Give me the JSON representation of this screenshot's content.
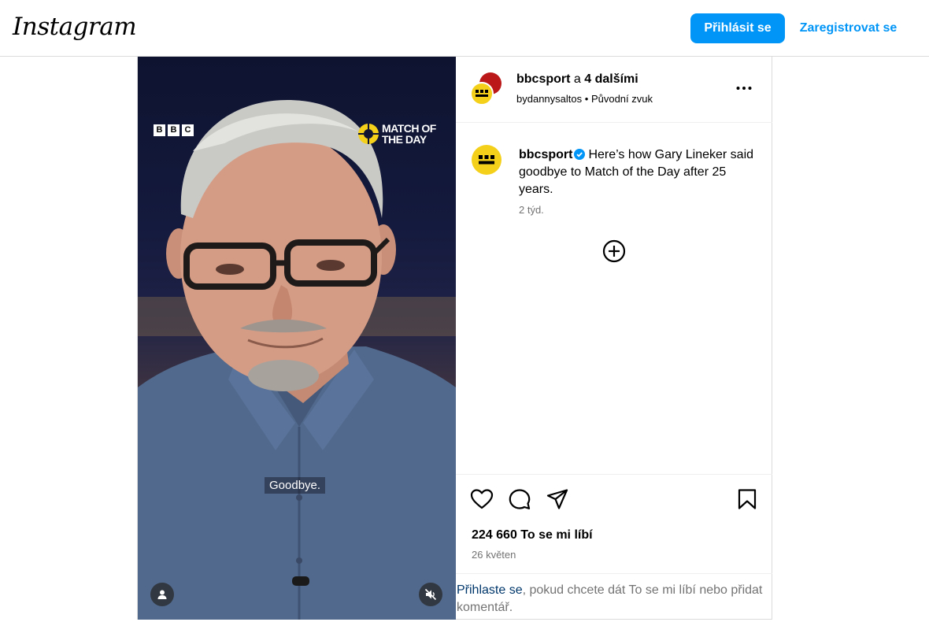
{
  "header": {
    "logo_text": "Instagram",
    "login_button": "Přihlásit se",
    "signup_button": "Zaregistrovat se"
  },
  "media": {
    "channel_logo_letters": [
      "B",
      "B",
      "C"
    ],
    "show_logo_text": "MATCH OF THE DAY",
    "subtitle": "Goodbye.",
    "user_tag_icon": "person-icon",
    "mute_icon": "speaker-muted-icon"
  },
  "post_header": {
    "username": "bbcsport",
    "joiner": " a ",
    "others": "4 dalšími",
    "audio_author": "bydannysaltos",
    "separator": "•",
    "audio_label": "Původní zvuk"
  },
  "caption": {
    "username": "bbcsport",
    "text": "Here’s how Gary Lineker said goodbye to Match of the Day after 25 years.",
    "time": "2 týd."
  },
  "actions": {
    "likes": "224 660 To se mi líbí",
    "date": "26 květen"
  },
  "login_prompt": {
    "link": "Přihlaste se",
    "rest": ", pokud chcete dát To se mi líbí nebo přidat komentář."
  },
  "colors": {
    "accent": "#0095f6",
    "bbc_yellow": "#f4d01b",
    "bbc_red": "#bb1919",
    "muted_text": "#737373",
    "link_dark": "#00376b"
  }
}
